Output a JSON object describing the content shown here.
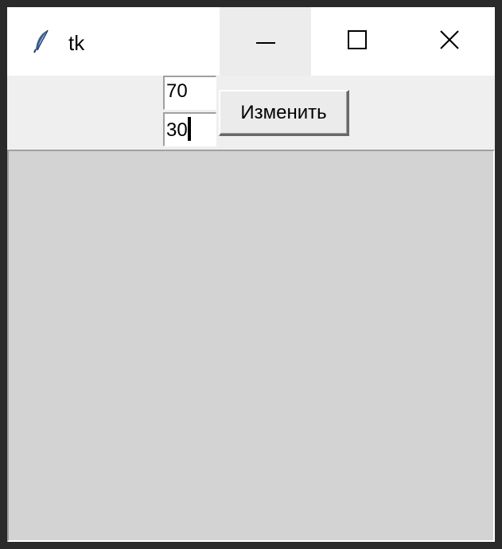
{
  "window": {
    "title": "tk",
    "icon": "tk-feather-icon",
    "controls": {
      "minimize": "minimize-icon",
      "maximize": "maximize-icon",
      "close": "close-icon"
    }
  },
  "form": {
    "entry_top_value": "70",
    "entry_bottom_value": "30",
    "change_button_label": "Изменить"
  },
  "canvas": {
    "background": "#d3d3d3"
  }
}
